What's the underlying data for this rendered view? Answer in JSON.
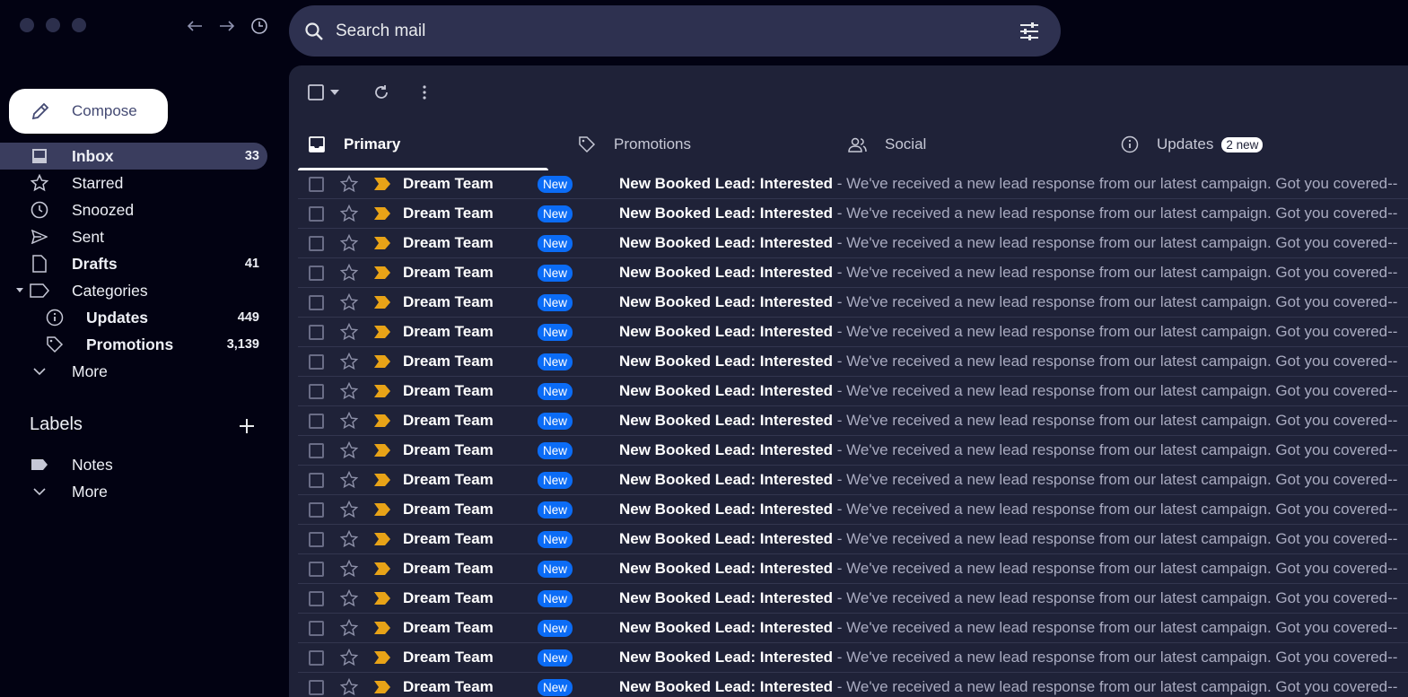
{
  "search": {
    "placeholder": "Search mail"
  },
  "compose": {
    "label": "Compose"
  },
  "nav": [
    {
      "label": "Inbox",
      "count": "33",
      "icon": "inbox-icon"
    },
    {
      "label": "Starred",
      "count": "",
      "icon": "star-icon"
    },
    {
      "label": "Snoozed",
      "count": "",
      "icon": "clock-icon"
    },
    {
      "label": "Sent",
      "count": "",
      "icon": "send-icon"
    },
    {
      "label": "Drafts",
      "count": "41",
      "icon": "draft-icon"
    },
    {
      "label": "Categories",
      "count": "",
      "icon": "label-icon"
    },
    {
      "label": "Updates",
      "count": "449",
      "icon": "info-icon"
    },
    {
      "label": "Promotions",
      "count": "3,139",
      "icon": "tag-icon"
    },
    {
      "label": "More",
      "count": "",
      "icon": "chevron-down-icon"
    }
  ],
  "labels": {
    "title": "Labels",
    "items": [
      {
        "label": "Notes",
        "icon": "label-filled-icon"
      },
      {
        "label": "More",
        "icon": "chevron-down-icon"
      }
    ]
  },
  "tabs": [
    {
      "label": "Primary",
      "icon": "inbox-icon"
    },
    {
      "label": "Promotions",
      "icon": "tag-icon"
    },
    {
      "label": "Social",
      "icon": "people-icon"
    },
    {
      "label": "Updates",
      "icon": "info-icon",
      "badge": "2 new"
    }
  ],
  "emails": [
    {
      "sender": "Dream Team",
      "badge": "New",
      "subject": "New Booked Lead: Interested",
      "snippet": " - We've received a new lead response from our latest campaign. Got you covered--"
    },
    {
      "sender": "Dream Team",
      "badge": "New",
      "subject": "New Booked Lead: Interested",
      "snippet": " - We've received a new lead response from our latest campaign. Got you covered--"
    },
    {
      "sender": "Dream Team",
      "badge": "New",
      "subject": "New Booked Lead: Interested",
      "snippet": " - We've received a new lead response from our latest campaign. Got you covered--"
    },
    {
      "sender": "Dream Team",
      "badge": "New",
      "subject": "New Booked Lead: Interested",
      "snippet": " - We've received a new lead response from our latest campaign. Got you covered--"
    },
    {
      "sender": "Dream Team",
      "badge": "New",
      "subject": "New Booked Lead: Interested",
      "snippet": " - We've received a new lead response from our latest campaign. Got you covered--"
    },
    {
      "sender": "Dream Team",
      "badge": "New",
      "subject": "New Booked Lead: Interested",
      "snippet": " - We've received a new lead response from our latest campaign. Got you covered--"
    },
    {
      "sender": "Dream Team",
      "badge": "New",
      "subject": "New Booked Lead: Interested",
      "snippet": " - We've received a new lead response from our latest campaign. Got you covered--"
    },
    {
      "sender": "Dream Team",
      "badge": "New",
      "subject": "New Booked Lead: Interested",
      "snippet": " - We've received a new lead response from our latest campaign. Got you covered--"
    },
    {
      "sender": "Dream Team",
      "badge": "New",
      "subject": "New Booked Lead: Interested",
      "snippet": " - We've received a new lead response from our latest campaign. Got you covered--"
    },
    {
      "sender": "Dream Team",
      "badge": "New",
      "subject": "New Booked Lead: Interested",
      "snippet": " - We've received a new lead response from our latest campaign. Got you covered--"
    },
    {
      "sender": "Dream Team",
      "badge": "New",
      "subject": "New Booked Lead: Interested",
      "snippet": " - We've received a new lead response from our latest campaign. Got you covered--"
    },
    {
      "sender": "Dream Team",
      "badge": "New",
      "subject": "New Booked Lead: Interested",
      "snippet": " - We've received a new lead response from our latest campaign. Got you covered--"
    },
    {
      "sender": "Dream Team",
      "badge": "New",
      "subject": "New Booked Lead: Interested",
      "snippet": " - We've received a new lead response from our latest campaign. Got you covered--"
    },
    {
      "sender": "Dream Team",
      "badge": "New",
      "subject": "New Booked Lead: Interested",
      "snippet": " - We've received a new lead response from our latest campaign. Got you covered--"
    },
    {
      "sender": "Dream Team",
      "badge": "New",
      "subject": "New Booked Lead: Interested",
      "snippet": " - We've received a new lead response from our latest campaign. Got you covered--"
    },
    {
      "sender": "Dream Team",
      "badge": "New",
      "subject": "New Booked Lead: Interested",
      "snippet": " - We've received a new lead response from our latest campaign. Got you covered--"
    },
    {
      "sender": "Dream Team",
      "badge": "New",
      "subject": "New Booked Lead: Interested",
      "snippet": " - We've received a new lead response from our latest campaign. Got you covered--"
    },
    {
      "sender": "Dream Team",
      "badge": "New",
      "subject": "New Booked Lead: Interested",
      "snippet": " - We've received a new lead response from our latest campaign. Got you covered--"
    }
  ],
  "colors": {
    "important_marker": "#e8a317",
    "new_badge": "#0b6cf6",
    "active_nav": "#3a3d5e"
  }
}
